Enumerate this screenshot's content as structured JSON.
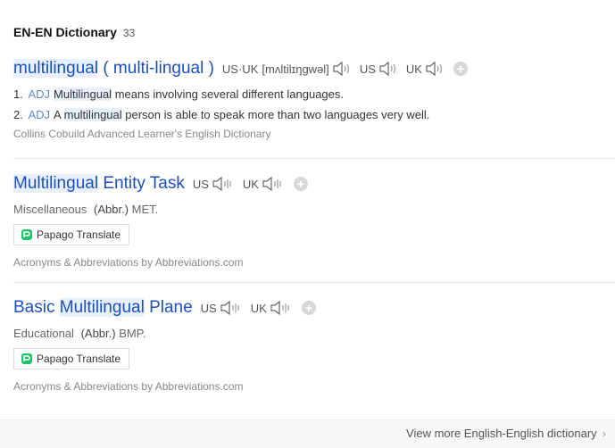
{
  "section": {
    "title": "EN-EN Dictionary",
    "count": "33"
  },
  "entries": [
    {
      "headword_pre": "",
      "headword_hl": "multilingual",
      "headword_post": " ( multi-lingual )",
      "pron": [
        {
          "label": "US·UK",
          "ipa": "[mʌltilɪŋgwəl]"
        },
        {
          "label": "US",
          "ipa": ""
        },
        {
          "label": "UK",
          "ipa": ""
        }
      ],
      "senses": [
        {
          "num": "1.",
          "pos": "ADJ",
          "pre": "",
          "hl": "Multilingual",
          "post": " means involving several different languages."
        },
        {
          "num": "2.",
          "pos": "ADJ",
          "pre": "A ",
          "hl": "multilingual",
          "post": " person is able to speak more than two languages very well."
        }
      ],
      "source": "Collins Cobuild Advanced Learner's English Dictionary"
    },
    {
      "headword_pre": "",
      "headword_hl": "Multilingual",
      "headword_post": " Entity Task",
      "pron": [
        {
          "label": "US"
        },
        {
          "label": "UK"
        }
      ],
      "category": "Miscellaneous",
      "abbr_label": "(Abbr.)",
      "abbr_value": "MET.",
      "button": "Papago Translate",
      "source": "Acronyms & Abbreviations by Abbreviations.com"
    },
    {
      "headword_pre": "Basic ",
      "headword_hl": "Multilingual",
      "headword_post": " Plane",
      "pron": [
        {
          "label": "US"
        },
        {
          "label": "UK"
        }
      ],
      "category": "Educational",
      "abbr_label": "(Abbr.)",
      "abbr_value": "BMP.",
      "button": "Papago Translate",
      "source": "Acronyms & Abbreviations by Abbreviations.com"
    }
  ],
  "footer": {
    "view_more": "View more English-English dictionary"
  },
  "colors": {
    "headword": "#1c4fbd",
    "highlight": "#e8f1fb",
    "pos": "#5b8ad6",
    "source": "#888888",
    "papago_green": "#1ec36b"
  }
}
